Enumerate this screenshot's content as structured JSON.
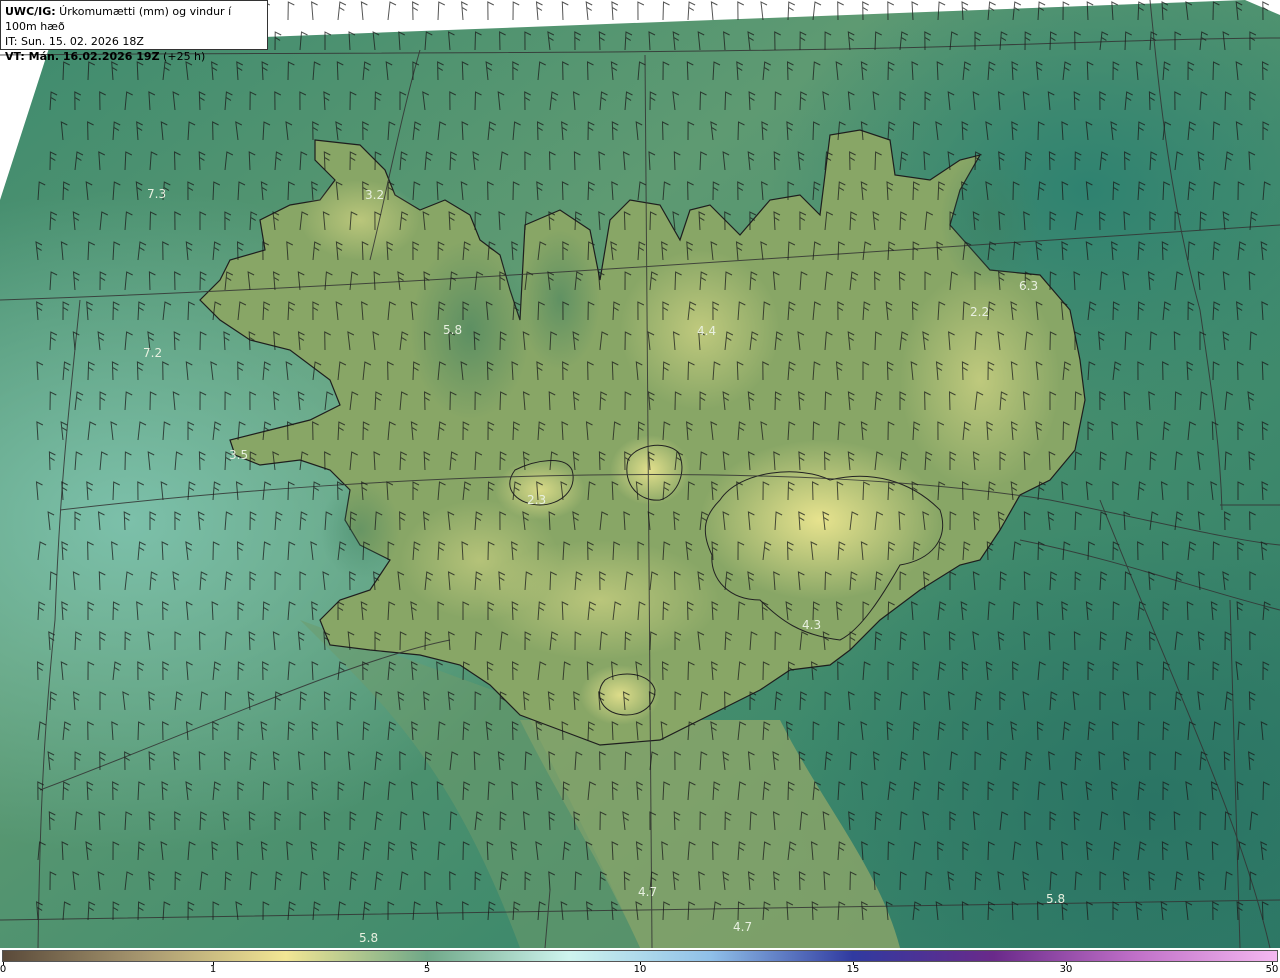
{
  "header": {
    "line1_prefix": "UWC/IG:",
    "line1_rest": " Úrkomumætti (mm) og vindur í 100m hæð",
    "line2": "IT: Sun. 15. 02. 2026 18Z",
    "line3_prefix": "VT: Mán. 16.02.2026 19Z",
    "line3_rest": " (+25 h)"
  },
  "map_labels": [
    "7.3",
    "3.2",
    "5.8",
    "7.2",
    "3.5",
    "2.3",
    "4.4",
    "6.3",
    "2.2",
    "4.3",
    "4.7",
    "4.7",
    "5.8",
    "5.8"
  ],
  "colorbar": {
    "ticks": [
      "0",
      "1",
      "5",
      "10",
      "15",
      "30",
      "50"
    ],
    "colors": [
      "#5a4a3a",
      "#a89870",
      "#f2e694",
      "#6fa888",
      "#cef4ee",
      "#8fbfe8",
      "#303aa0",
      "#6a2a8a",
      "#c070c8",
      "#f4b8f0"
    ]
  },
  "colors": {
    "sea_dark": "#2e7a66",
    "sea_light": "#7dbfaa",
    "land_green": "#7d9c62",
    "land_yellow": "#e6e08c",
    "coastline": "#222222",
    "gridline": "#333333"
  }
}
